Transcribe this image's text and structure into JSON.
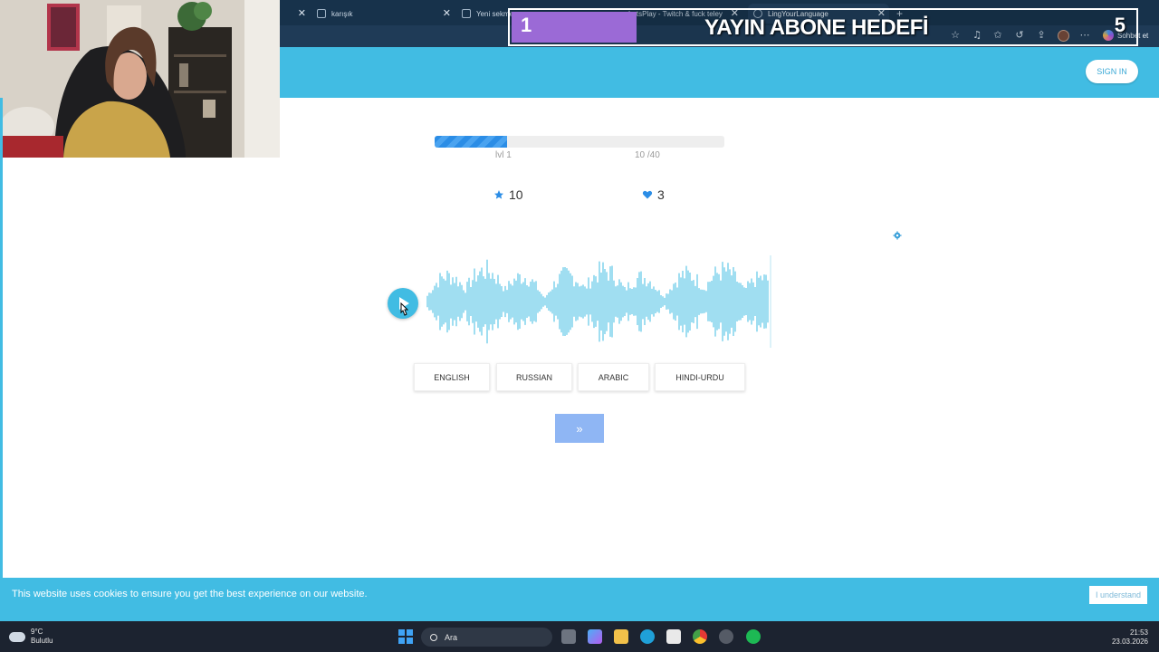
{
  "browser": {
    "tabs": [
      {
        "label": "karışık"
      },
      {
        "label": "Yeni sekme"
      },
      {
        "label": "LetsPlay - Twitch & fuck teleyis"
      },
      {
        "label": "LingYourLanguage",
        "active": true
      }
    ],
    "chat_button": "Sohbet et"
  },
  "overlay": {
    "goal_title": "YAYIN ABONE HEDEFİ",
    "current": "1",
    "target": "5",
    "fill_fraction": 0.2
  },
  "site": {
    "signin_label": "SIGN IN"
  },
  "quiz": {
    "progress_fraction": 0.25,
    "level_label": "lvl 1",
    "count_label": "10 /40",
    "stars": "10",
    "hearts": "3",
    "languages": [
      "ENGLISH",
      "RUSSIAN",
      "ARABIC",
      "HINDI-URDU"
    ],
    "next_label": "»"
  },
  "cookie": {
    "text": "This website uses cookies to ensure you get the best experience on our website.",
    "button": "I understand"
  },
  "taskbar": {
    "temperature": "9°C",
    "weather": "Bulutlu",
    "search_placeholder": "Ara",
    "time": "21:53",
    "date": "23.03.2026"
  },
  "colors": {
    "accent": "#41bce3",
    "progress": "#2b8de6",
    "goal_fill": "#9b6ad6",
    "next_button": "#8fb6f4"
  },
  "icons": [
    "star-icon",
    "heart-icon",
    "gear-icon",
    "play-icon",
    "windows-start-icon",
    "search-icon"
  ]
}
